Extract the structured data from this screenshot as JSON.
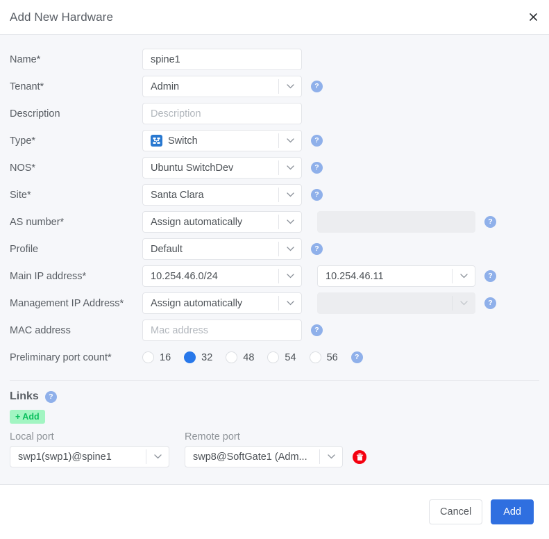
{
  "dialog": {
    "title": "Add New Hardware",
    "close_icon": "close-icon"
  },
  "form": {
    "rows": [
      {
        "label": "Name*",
        "type": "text",
        "value": "spine1",
        "placeholder": "",
        "help": false
      },
      {
        "label": "Tenant*",
        "type": "select",
        "value": "Admin",
        "help": true
      },
      {
        "label": "Description",
        "type": "text",
        "value": "",
        "placeholder": "Description",
        "help": false
      },
      {
        "label": "Type*",
        "type": "select-icon",
        "value": "Switch",
        "icon": "switch-icon",
        "help": true
      },
      {
        "label": "NOS*",
        "type": "select",
        "value": "Ubuntu SwitchDev",
        "help": true
      },
      {
        "label": "Site*",
        "type": "select",
        "value": "Santa Clara",
        "help": true
      },
      {
        "label": "AS number*",
        "type": "select+disabled",
        "value": "Assign automatically",
        "second_value": "",
        "help": true
      },
      {
        "label": "Profile",
        "type": "select",
        "value": "Default",
        "help": true
      },
      {
        "label": "Main IP address*",
        "type": "select+select",
        "value": "10.254.46.0/24",
        "second_value": "10.254.46.11",
        "help": true
      },
      {
        "label": "Management IP Address*",
        "type": "select+disabled-select",
        "value": "Assign automatically",
        "second_value": "",
        "help": true
      },
      {
        "label": "MAC address",
        "type": "text",
        "value": "",
        "placeholder": "Mac address",
        "help": true
      }
    ],
    "port_count": {
      "label": "Preliminary port count*",
      "options": [
        "16",
        "32",
        "48",
        "54",
        "56"
      ],
      "selected": "32",
      "help": true
    }
  },
  "links": {
    "title": "Links",
    "help": true,
    "add_label": "+ Add",
    "columns": {
      "local": "Local port",
      "remote": "Remote port"
    },
    "rows": [
      {
        "local_port": "swp1(swp1)@spine1",
        "remote_port": "swp8@SoftGate1 (Adm...",
        "delete_icon": "trash-icon"
      }
    ]
  },
  "footer": {
    "cancel_label": "Cancel",
    "add_label": "Add"
  },
  "colors": {
    "accent_blue": "#2f6fe0",
    "help_badge": "#8fb0ea",
    "add_green_bg": "#a2f5c2",
    "add_green_text": "#0bbf5e",
    "delete_red": "#f4000f",
    "body_bg": "#f6f7fa",
    "radio_selected": "#2878ea",
    "type_icon_blue": "#2878d0"
  },
  "icons": {
    "help": "?",
    "close": "✕"
  }
}
